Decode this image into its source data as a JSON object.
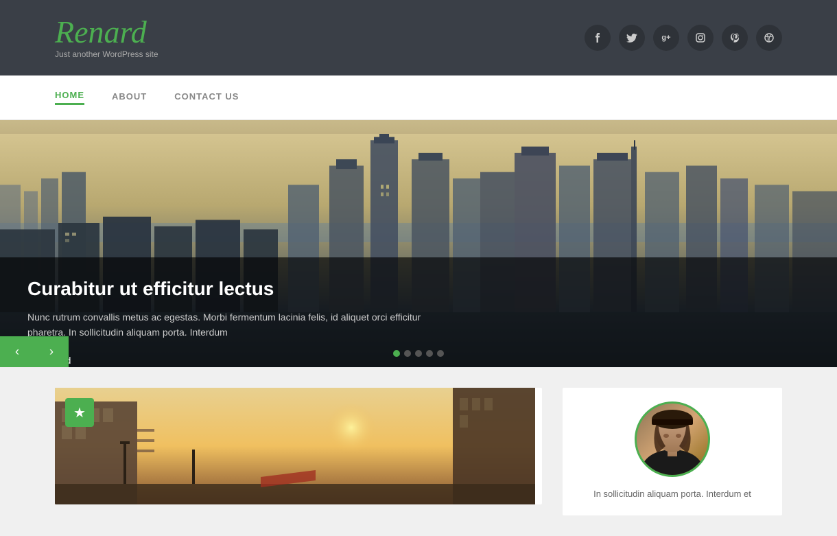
{
  "site": {
    "logo": "Renard",
    "tagline": "Just another WordPress site"
  },
  "social": [
    {
      "name": "facebook",
      "icon": "f"
    },
    {
      "name": "twitter",
      "icon": "t"
    },
    {
      "name": "google-plus",
      "icon": "g+"
    },
    {
      "name": "instagram",
      "icon": "ig"
    },
    {
      "name": "pinterest",
      "icon": "p"
    },
    {
      "name": "dribbble",
      "icon": "dr"
    }
  ],
  "nav": {
    "items": [
      {
        "label": "HOME",
        "active": true
      },
      {
        "label": "ABOUT",
        "active": false
      },
      {
        "label": "CONTACT US",
        "active": false
      }
    ]
  },
  "hero": {
    "title": "Curabitur ut efficitur lectus",
    "description": "Nunc rutrum convallis metus ac egestas. Morbi fermentum lacinia felis, id aliquet orci efficitur pharetra. In sollicitudin aliquam porta. Interdum",
    "read_label": "Read",
    "dots": [
      true,
      false,
      false,
      false,
      false
    ],
    "prev_label": "‹",
    "next_label": "›"
  },
  "featured": {
    "badge_icon": "★"
  },
  "sidebar": {
    "author_text": "In sollicitudin aliquam porta. Interdum et"
  }
}
